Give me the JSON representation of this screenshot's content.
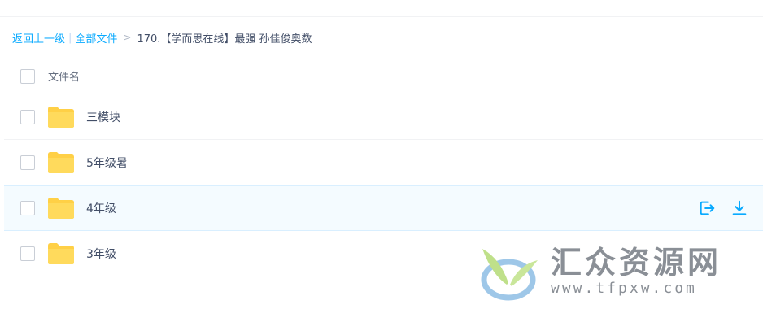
{
  "breadcrumb": {
    "back": "返回上一级",
    "separator": "|",
    "all_files": "全部文件",
    "arrow": ">",
    "current": "170.【学而思在线】最强 孙佳俊奥数"
  },
  "header": {
    "column_label": "文件名"
  },
  "rows": [
    {
      "name": "三模块"
    },
    {
      "name": "5年级暑"
    },
    {
      "name": "4年级"
    },
    {
      "name": "3年级"
    }
  ],
  "watermark": {
    "title": "汇众资源网",
    "url": "www.tfpxw.com"
  },
  "colors": {
    "accent": "#09aaff",
    "folder": "#ffd046",
    "row_hover": "#f4fbff"
  },
  "icons": {
    "folder": "folder-icon",
    "share": "share-export-icon",
    "download": "download-icon"
  }
}
